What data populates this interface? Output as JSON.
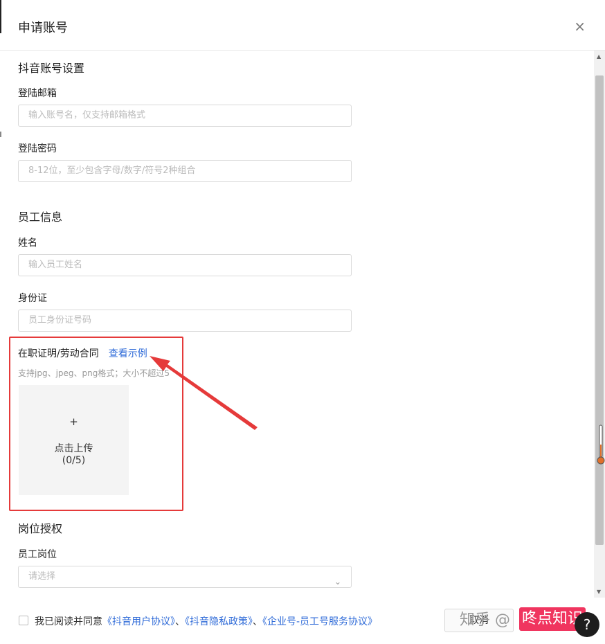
{
  "dialog": {
    "title": "申请账号",
    "close_glyph": "×"
  },
  "sections": {
    "douyin": {
      "title": "抖音账号设置",
      "email_label": "登陆邮箱",
      "email_placeholder": "输入账号名，仅支持邮箱格式",
      "password_label": "登陆密码",
      "password_placeholder": "8-12位，至少包含字母/数字/符号2种组合"
    },
    "employee": {
      "title": "员工信息",
      "name_label": "姓名",
      "name_placeholder": "输入员工姓名",
      "id_label": "身份证",
      "id_placeholder": "员工身份证号码",
      "proof_label": "在职证明/劳动合同",
      "proof_example_link": "查看示例",
      "proof_hint": "支持jpg、jpeg、png格式；大小不超过5",
      "upload_plus": "+",
      "upload_text": "点击上传",
      "upload_count": "(0/5)"
    },
    "position": {
      "title": "岗位授权",
      "post_label": "员工岗位",
      "post_placeholder": "请选择",
      "chevron": "⌄"
    }
  },
  "footer": {
    "agree_prefix": "我已阅读并同意",
    "agreement_1": "《抖音用户协议》",
    "sep_1": "、",
    "agreement_2": "《抖音隐私政策》",
    "sep_2": "、",
    "agreement_3": "《企业号-员工号服务协议》",
    "cancel_label": "取消"
  },
  "watermark": {
    "prefix": "知乎 @",
    "highlight": "咚点知识"
  },
  "help_glyph": "?",
  "colors": {
    "annotation_red": "#e53a3a",
    "link_blue": "#2f6bd8",
    "watermark_pink": "#f0355f"
  }
}
